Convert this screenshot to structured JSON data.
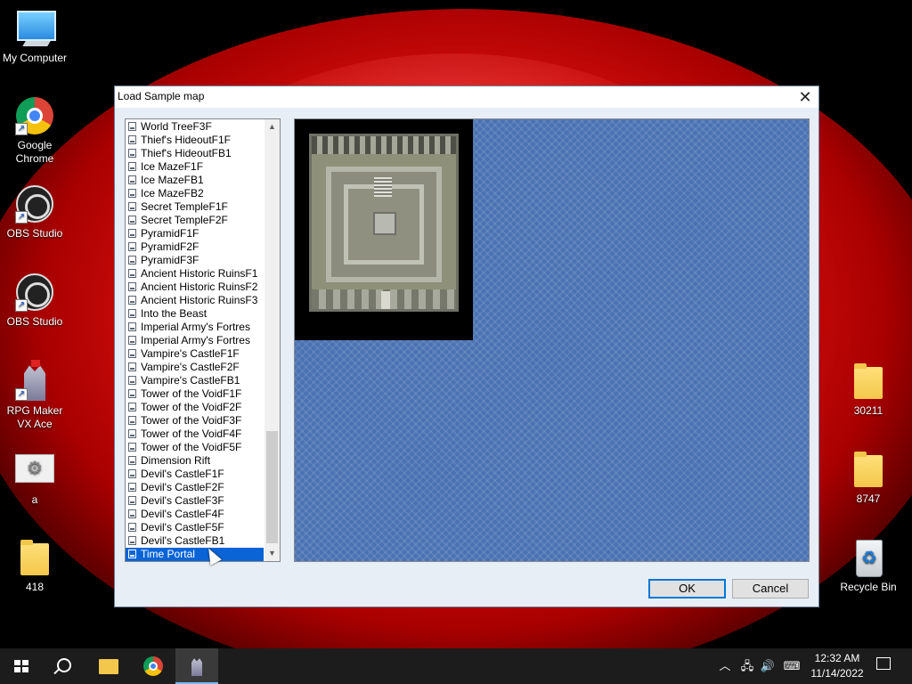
{
  "desktop": {
    "icons_left": [
      {
        "label": "My Computer",
        "icon": "computer-icon"
      },
      {
        "label": "Google Chrome",
        "icon": "chrome-icon"
      },
      {
        "label": "OBS Studio",
        "icon": "obs-icon"
      },
      {
        "label": "OBS Studio",
        "icon": "obs-icon"
      },
      {
        "label": "RPG Maker VX Ace",
        "icon": "rpg-maker-icon"
      },
      {
        "label": "a",
        "icon": "gear-file-icon"
      },
      {
        "label": "418",
        "icon": "folder-icon"
      }
    ],
    "icons_right": [
      {
        "label": "30211",
        "icon": "folder-icon"
      },
      {
        "label": "8747",
        "icon": "folder-icon"
      },
      {
        "label": "Recycle Bin",
        "icon": "recycle-bin-icon"
      }
    ]
  },
  "dialog": {
    "title": "Load Sample map",
    "close_glyph": "✕",
    "maps": [
      "World TreeF3F",
      "Thief's HideoutF1F",
      "Thief's HideoutFB1",
      "Ice MazeF1F",
      "Ice MazeFB1",
      "Ice MazeFB2",
      "Secret TempleF1F",
      "Secret TempleF2F",
      "PyramidF1F",
      "PyramidF2F",
      "PyramidF3F",
      "Ancient Historic RuinsF1",
      "Ancient Historic RuinsF2",
      "Ancient Historic RuinsF3",
      "Into the Beast",
      "Imperial Army's Fortres",
      "Imperial Army's Fortres",
      "Vampire's CastleF1F",
      "Vampire's CastleF2F",
      "Vampire's CastleFB1",
      "Tower of the VoidF1F",
      "Tower of the VoidF2F",
      "Tower of the VoidF3F",
      "Tower of the VoidF4F",
      "Tower of the VoidF5F",
      "Dimension Rift",
      "Devil's CastleF1F",
      "Devil's CastleF2F",
      "Devil's CastleF3F",
      "Devil's CastleF4F",
      "Devil's CastleF5F",
      "Devil's CastleFB1",
      "Time Portal"
    ],
    "selected_map": "Time Portal",
    "ok_label": "OK",
    "cancel_label": "Cancel"
  },
  "taskbar": {
    "time": "12:32 AM",
    "date": "11/14/2022",
    "pinned": [
      "windows-start-icon",
      "search-icon",
      "file-explorer-icon",
      "chrome-icon",
      "rpg-maker-icon"
    ]
  }
}
